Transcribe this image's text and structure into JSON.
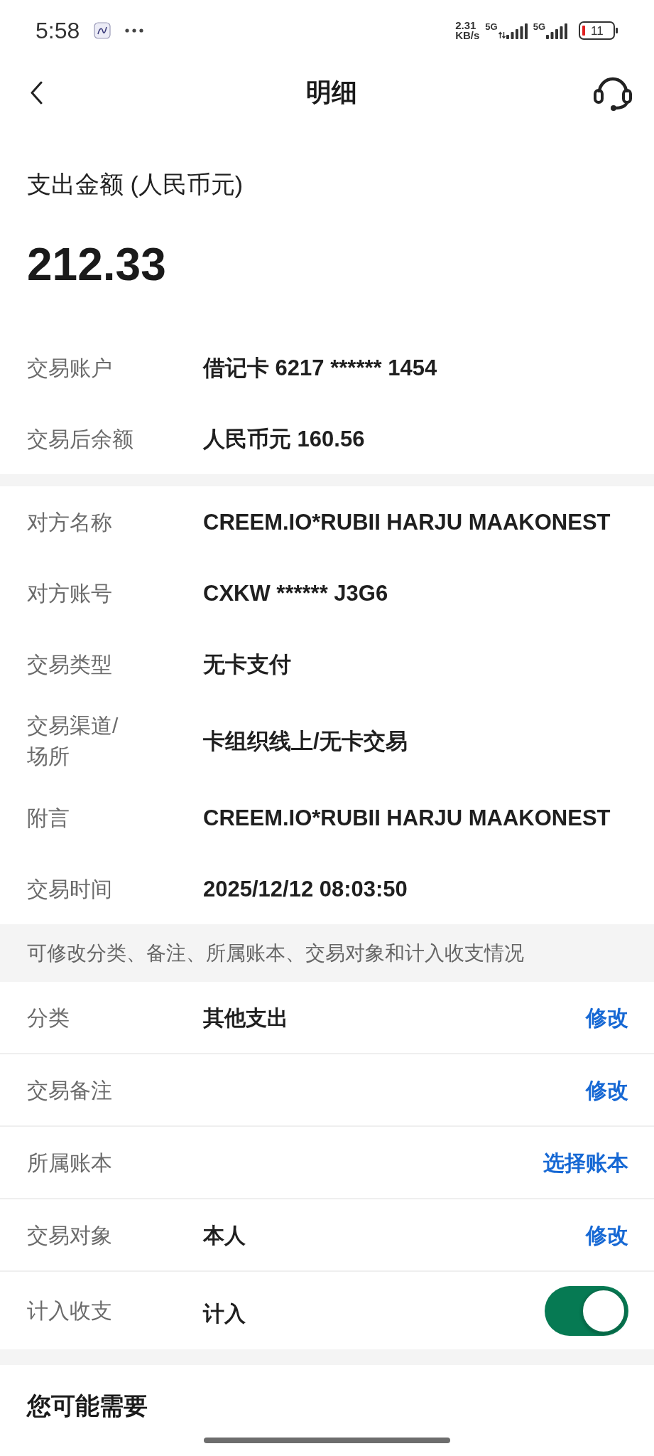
{
  "status_bar": {
    "time": "5:58",
    "network_speed": {
      "value": "2.31",
      "unit": "KB/s"
    },
    "signals": [
      {
        "label": "5G",
        "transferring": true
      },
      {
        "label": "5G",
        "transferring": false
      }
    ],
    "battery": {
      "text": "11"
    }
  },
  "header": {
    "title": "明细"
  },
  "amount": {
    "label": "支出金额 (人民币元)",
    "value": "212.33"
  },
  "account_rows": [
    {
      "label": "交易账户",
      "value": "借记卡 6217 ****** 1454"
    },
    {
      "label": "交易后余额",
      "value": "人民币元 160.56"
    }
  ],
  "detail_rows": [
    {
      "label": "对方名称",
      "value": "CREEM.IO*RUBII HARJU MAAKONEST"
    },
    {
      "label": "对方账号",
      "value": "CXKW ****** J3G6"
    },
    {
      "label": "交易类型",
      "value": "无卡支付"
    },
    {
      "label": "交易渠道/场所",
      "value": "卡组织线上/无卡交易"
    },
    {
      "label": "附言",
      "value": "CREEM.IO*RUBII HARJU MAAKONEST"
    },
    {
      "label": "交易时间",
      "value": "2025/12/12 08:03:50"
    }
  ],
  "edit_note": "可修改分类、备注、所属账本、交易对象和计入收支情况",
  "edit_rows": [
    {
      "kind": "link",
      "label": "分类",
      "value": "其他支出",
      "action": "修改"
    },
    {
      "kind": "link",
      "label": "交易备注",
      "action": "修改"
    },
    {
      "kind": "link",
      "label": "所属账本",
      "action": "选择账本"
    },
    {
      "kind": "link",
      "label": "交易对象",
      "value": "本人",
      "action": "修改"
    },
    {
      "kind": "toggle",
      "label": "计入收支",
      "value": "计入",
      "on": true
    }
  ],
  "suggestions": {
    "title": "您可能需要"
  }
}
